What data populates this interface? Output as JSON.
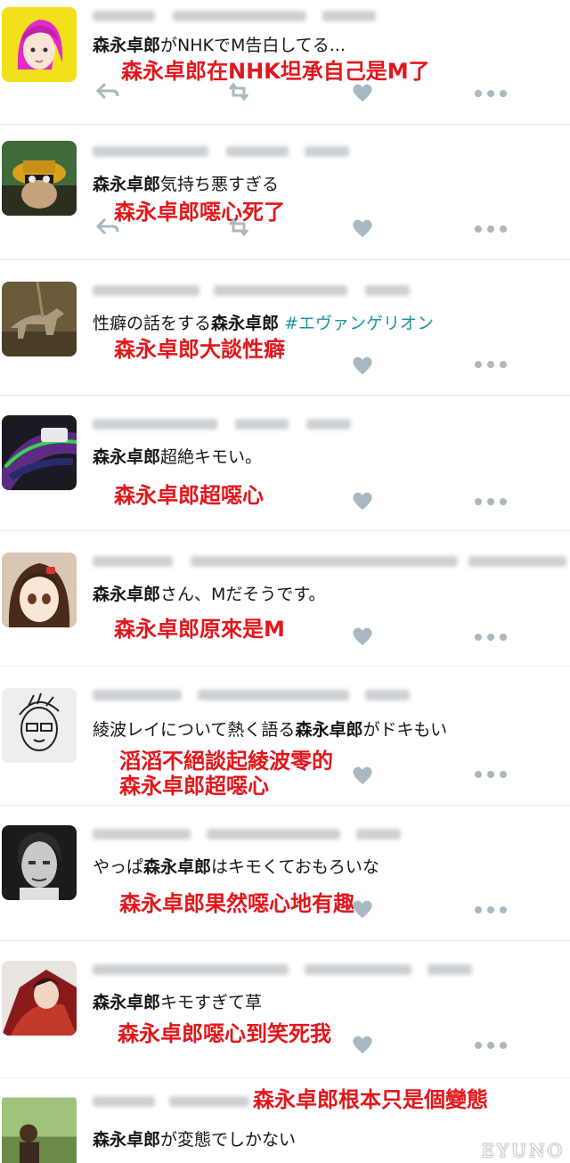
{
  "tweets": [
    {
      "bold": "森永卓郎",
      "before": "",
      "after": "がNHKでM告白してる...",
      "hashtag": "",
      "caption": [
        "森永卓郎在NHK坦承自己是M了"
      ]
    },
    {
      "bold": "森永卓郎",
      "before": "",
      "after": "気持ち悪すぎる",
      "hashtag": "",
      "caption": [
        "森永卓郎噁心死了"
      ]
    },
    {
      "bold": "森永卓郎",
      "before": "性癖の話をする",
      "after": " ",
      "hashtag": "#エヴァンゲリオン",
      "caption": [
        "森永卓郎大談性癖"
      ]
    },
    {
      "bold": "森永卓郎",
      "before": "",
      "after": "超絶キモい。",
      "hashtag": "",
      "caption": [
        "森永卓郎超噁心"
      ]
    },
    {
      "bold": "森永卓郎",
      "before": "",
      "after": "さん、Mだそうです。",
      "hashtag": "",
      "caption": [
        "森永卓郎原來是M"
      ]
    },
    {
      "bold": "森永卓郎",
      "before": "綾波レイについて熱く語る",
      "after": "がドキもい",
      "hashtag": "",
      "caption": [
        "滔滔不絕談起綾波零的",
        "森永卓郎超噁心"
      ]
    },
    {
      "bold": "森永卓郎",
      "before": "やっぱ",
      "after": "はキモくておもろいな",
      "hashtag": "",
      "caption": [
        "森永卓郎果然噁心地有趣"
      ]
    },
    {
      "bold": "森永卓郎",
      "before": "",
      "after": "キモすぎて草",
      "hashtag": "",
      "caption": [
        "森永卓郎噁心到笑死我"
      ]
    },
    {
      "bold": "森永卓郎",
      "before": "",
      "after": "が変態でしかない",
      "hashtag": "",
      "caption": [
        "森永卓郎根本只是個變態"
      ]
    }
  ],
  "icons": {
    "reply": "reply-icon",
    "retweet": "retweet-icon",
    "like": "heart-icon",
    "more": "more-icon"
  },
  "colors": {
    "caption": "#e3161b",
    "hashtag": "#1b95a0",
    "icon": "#aab8c2"
  },
  "watermark": "EYUNO"
}
